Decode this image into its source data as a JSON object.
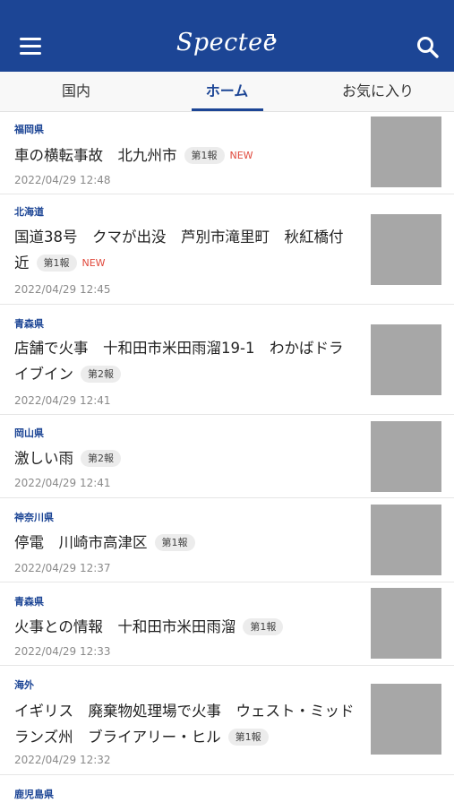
{
  "header": {
    "logo": "Spectee",
    "menu_icon": "hamburger-menu-icon",
    "search_icon": "search-icon",
    "color": "#1c4595"
  },
  "tabs": [
    {
      "label": "国内",
      "active": false
    },
    {
      "label": "ホーム",
      "active": true
    },
    {
      "label": "お気に入り",
      "active": false
    }
  ],
  "news": [
    {
      "prefecture": "福岡県",
      "title": "車の横転事故　北九州市",
      "badge": "第1報",
      "new": "NEW",
      "time": "2022/04/29 12:48"
    },
    {
      "prefecture": "北海道",
      "title": "国道38号　クマが出没　芦別市滝里町　秋紅橋付近",
      "badge": "第1報",
      "new": "NEW",
      "time": "2022/04/29 12:45"
    },
    {
      "prefecture": "青森県",
      "title": "店舗で火事　十和田市米田雨溜19-1　わかばドライブイン",
      "badge": "第2報",
      "new": "",
      "time": "2022/04/29 12:41"
    },
    {
      "prefecture": "岡山県",
      "title": "激しい雨",
      "badge": "第2報",
      "new": "",
      "time": "2022/04/29 12:41"
    },
    {
      "prefecture": "神奈川県",
      "title": "停電　川崎市高津区",
      "badge": "第1報",
      "new": "",
      "time": "2022/04/29 12:37"
    },
    {
      "prefecture": "青森県",
      "title": "火事との情報　十和田市米田雨溜",
      "badge": "第1報",
      "new": "",
      "time": "2022/04/29 12:33"
    },
    {
      "prefecture": "海外",
      "title": "イギリス　廃棄物処理場で火事　ウェスト・ミッドランズ州　ブライアリー・ヒル",
      "badge": "第1報",
      "new": "",
      "time": "2022/04/29 12:32"
    },
    {
      "prefecture": "鹿児島県",
      "title": "",
      "badge": "",
      "new": "",
      "time": ""
    }
  ]
}
